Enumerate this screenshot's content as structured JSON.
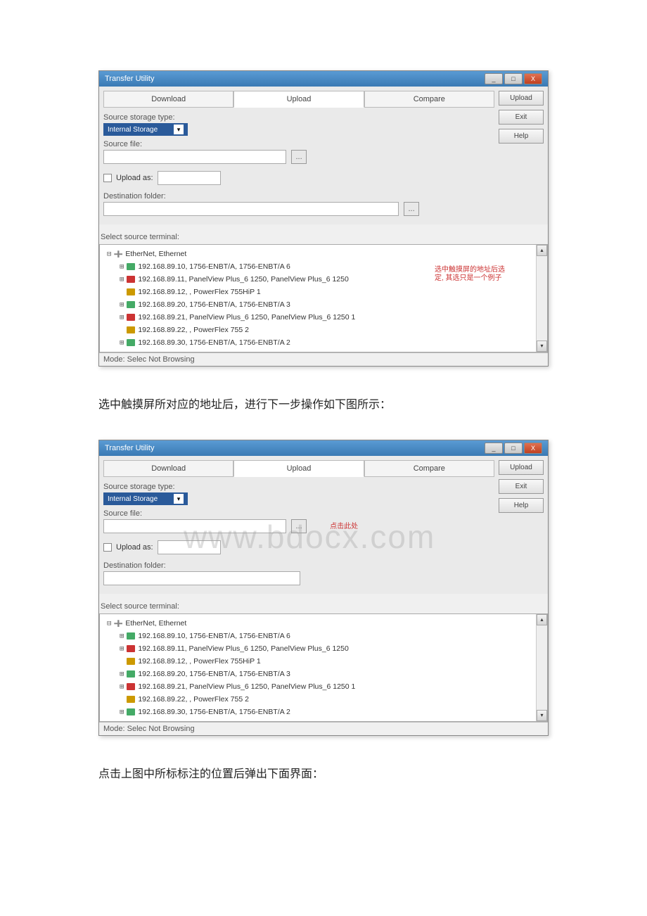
{
  "window_title": "Transfer Utility",
  "tabs": {
    "download": "Download",
    "upload": "Upload",
    "compare": "Compare"
  },
  "side_buttons": {
    "upload": "Upload",
    "exit": "Exit",
    "help": "Help"
  },
  "labels": {
    "source_storage_type": "Source storage type:",
    "source_file": "Source file:",
    "upload_as": "Upload as:",
    "destination_folder": "Destination folder:",
    "select_source_terminal": "Select source terminal:",
    "status_bar": "Mode: Selec Not Browsing"
  },
  "dropdown_value": "Internal Storage",
  "tree1": {
    "root": "EtherNet, Ethernet",
    "n0": "192.168.89.10, 1756-ENBT/A, 1756-ENBT/A 6",
    "n1": "192.168.89.11, PanelView Plus_6 1250, PanelView Plus_6 1250",
    "n2": "192.168.89.12, , PowerFlex 755HiP 1",
    "n3": "192.168.89.20, 1756-ENBT/A, 1756-ENBT/A 3",
    "n4": "192.168.89.21, PanelView Plus_6 1250, PanelView Plus_6 1250 1",
    "n5": "192.168.89.22, , PowerFlex 755 2",
    "n6": "192.168.89.30, 1756-ENBT/A, 1756-ENBT/A 2"
  },
  "annotation1_a": "选中触摸屏的地址后选",
  "annotation1_b": "定, 其选只是一个例子",
  "caption1": "选中触摸屏所对应的地址后，进行下一步操作如下图所示：",
  "tree2": {
    "root": "EtherNet, Ethernet",
    "n0": "192.168.89.10, 1756-ENBT/A, 1756-ENBT/A 6",
    "n1": "192.168.89.11, PanelView Plus_6 1250, PanelView Plus_6 1250",
    "n2": "192.168.89.12, , PowerFlex 755HiP 1",
    "n3": "192.168.89.20, 1756-ENBT/A, 1756-ENBT/A 3",
    "n4": "192.168.89.21, PanelView Plus_6 1250, PanelView Plus_6 1250 1",
    "n5": "192.168.89.22, , PowerFlex 755 2",
    "n6": "192.168.89.30, 1756-ENBT/A, 1756-ENBT/A 2"
  },
  "annotation2": "点击此处",
  "caption2": "点击上图中所标标注的位置后弹出下面界面：",
  "watermark": "www.bdocx.com"
}
